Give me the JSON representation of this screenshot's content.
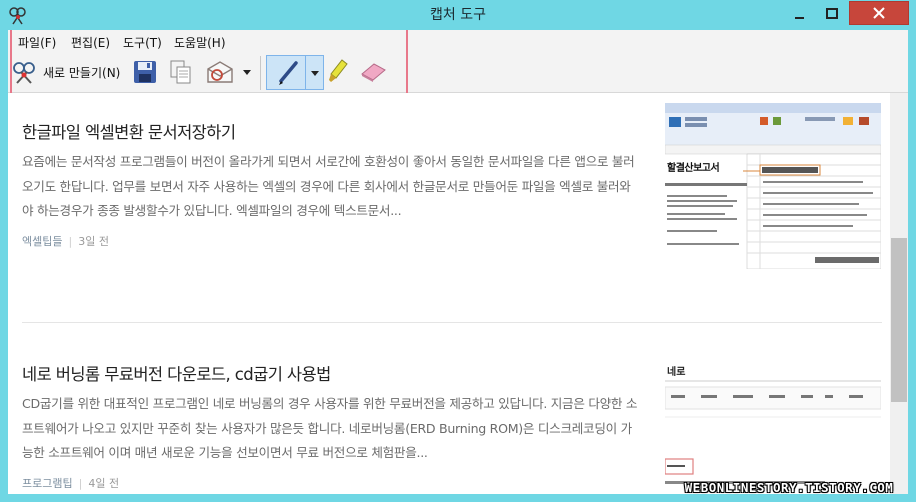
{
  "window": {
    "title": "캡처 도구",
    "close_glyph": "✕",
    "min_glyph": "—",
    "max_glyph": "□"
  },
  "menu": {
    "items": [
      {
        "label": "파일(F)"
      },
      {
        "label": "편집(E)"
      },
      {
        "label": "도구(T)"
      },
      {
        "label": "도움말(H)"
      }
    ]
  },
  "toolbar": {
    "new_label": "새로 만들기(N)",
    "new_icon": "scissors-icon",
    "save_icon": "floppy-icon",
    "copy_icon": "copy-icon",
    "send_icon": "envelope-icon",
    "pen_icon": "pen-icon",
    "highlighter_icon": "highlighter-icon",
    "eraser_icon": "eraser-icon"
  },
  "posts": [
    {
      "title": "한글파일 엑셀변환 문서저장하기",
      "body": "요즘에는 문서작성 프로그램들이 버전이 올라가게 되면서 서로간에 호환성이 좋아서 동일한 문서파일을 다른 앱으로 불러오기도 한답니다. 업무를 보면서 자주 사용하는 엑셀의 경우에 다른 회사에서 한글문서로 만들어둔 파일을 엑셀로 불러와야 하는경우가 종종 발생할수가 있답니다. 엑셀파일의 경우에 텍스트문서...",
      "category": "엑셀팁들",
      "date": "3일 전",
      "thumb_caption": "할결산보고서"
    },
    {
      "title": "네로 버닝롬 무료버전 다운로드, cd굽기 사용법",
      "body": "CD굽기를 위한 대표적인 프로그램인 네로 버닝롬의 경우 사용자를 위한 무료버전을 제공하고 있답니다. 지금은 다양한 소프트웨어가 나오고 있지만 꾸준히 찾는 사용자가 많은듯 합니다. 네로버닝롬(ERD Burning ROM)은 디스크레코딩이 가능한 소프트웨어 이며 매년 새로운 기능을 선보이면서 무료 버전으로 체험판을...",
      "category": "프로그램팁",
      "date": "4일 전",
      "thumb_caption": "네로"
    }
  ],
  "watermark": "WEBONLINESTORY.TISTORY.COM",
  "colors": {
    "frame": "#6fd7e4",
    "close": "#c7463b",
    "highlight": "#e8788a",
    "active_tool": "#cce4f7"
  }
}
